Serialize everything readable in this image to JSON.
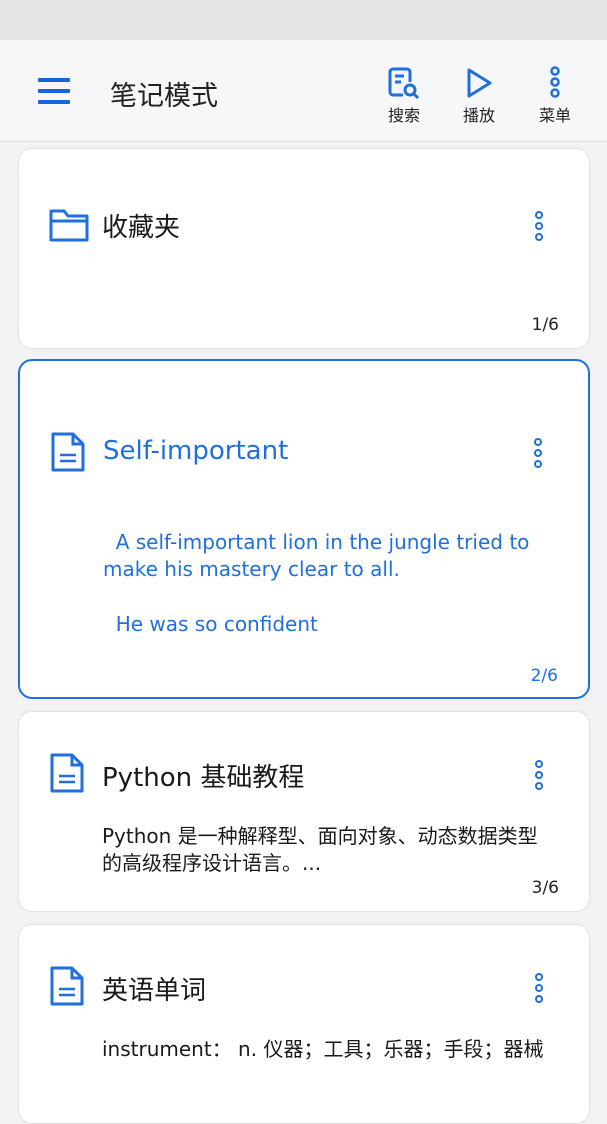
{
  "app_bar": {
    "title": "笔记模式",
    "actions": [
      {
        "label": "搜索",
        "icon": "search-document-icon"
      },
      {
        "label": "播放",
        "icon": "play-icon"
      },
      {
        "label": "菜单",
        "icon": "more-vertical-icon"
      }
    ]
  },
  "colors": {
    "accent": "#1f6fdc",
    "text": "#1a1a1a",
    "background": "#f2f2f4"
  },
  "notes": [
    {
      "icon": "folder-icon",
      "title": "收藏夹",
      "body": [],
      "page": "1/6",
      "selected": false
    },
    {
      "icon": "document-icon",
      "title": "Self-important",
      "body": [
        "  A self-important lion in the jungle tried to make his mastery clear to all.",
        "  He was so confident"
      ],
      "page": "2/6",
      "selected": true
    },
    {
      "icon": "document-icon",
      "title": "Python 基础教程",
      "body": [
        "Python 是一种解释型、面向对象、动态数据类型的高级程序设计语言。..."
      ],
      "page": "3/6",
      "selected": false
    },
    {
      "icon": "document-icon",
      "title": "英语单词",
      "body": [
        "instrument： n. 仪器；工具；乐器；手段；器械"
      ],
      "page": "",
      "selected": false
    }
  ]
}
